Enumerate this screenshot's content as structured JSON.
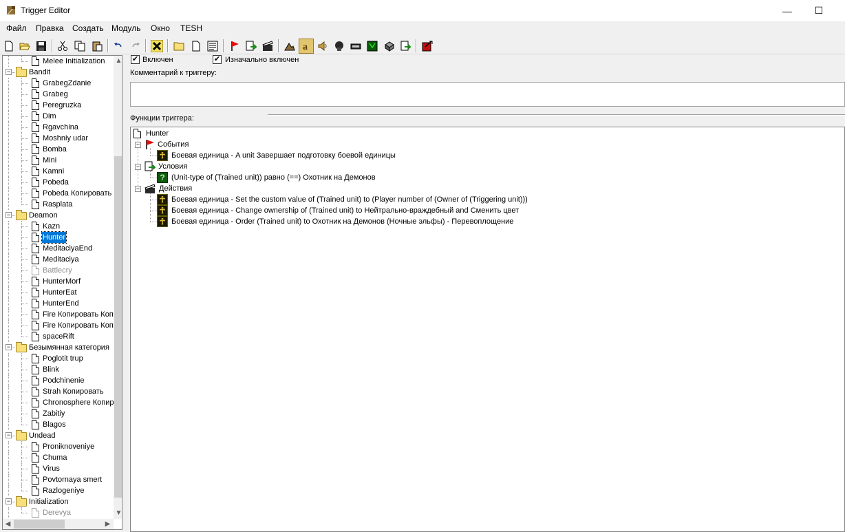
{
  "window": {
    "title": "Trigger Editor",
    "minimize": "—",
    "maximize": "☐"
  },
  "menu": [
    "Файл",
    "Правка",
    "Создать",
    "Модуль",
    "Окно",
    "TESH"
  ],
  "tree": {
    "rows": [
      {
        "label": "Melee Initialization",
        "type": "trigger",
        "level": 2
      },
      {
        "label": "Bandit",
        "type": "folder",
        "level": 1
      },
      {
        "label": "GrabegZdanie",
        "type": "trigger",
        "level": 2
      },
      {
        "label": "Grabeg",
        "type": "trigger",
        "level": 2
      },
      {
        "label": "Peregruzka",
        "type": "trigger",
        "level": 2
      },
      {
        "label": "Dim",
        "type": "trigger",
        "level": 2
      },
      {
        "label": "Rgavchina",
        "type": "trigger",
        "level": 2
      },
      {
        "label": "Moshniy udar",
        "type": "trigger",
        "level": 2
      },
      {
        "label": "Bomba",
        "type": "trigger",
        "level": 2
      },
      {
        "label": "Mini",
        "type": "trigger",
        "level": 2
      },
      {
        "label": "Kamni",
        "type": "trigger",
        "level": 2
      },
      {
        "label": "Pobeda",
        "type": "trigger",
        "level": 2
      },
      {
        "label": "Pobeda Копировать",
        "type": "trigger",
        "level": 2
      },
      {
        "label": "Rasplata",
        "type": "trigger",
        "level": 2
      },
      {
        "label": "Deamon",
        "type": "folder",
        "level": 1
      },
      {
        "label": "Kazn",
        "type": "trigger",
        "level": 2
      },
      {
        "label": "Hunter",
        "type": "trigger",
        "level": 2,
        "selected": true
      },
      {
        "label": "MeditaciyaEnd",
        "type": "trigger",
        "level": 2
      },
      {
        "label": "Meditaciya",
        "type": "trigger",
        "level": 2
      },
      {
        "label": "Battlecry",
        "type": "trigger",
        "level": 2,
        "disabled": true
      },
      {
        "label": "HunterMorf",
        "type": "trigger",
        "level": 2
      },
      {
        "label": "HunterEat",
        "type": "trigger",
        "level": 2
      },
      {
        "label": "HunterEnd",
        "type": "trigger",
        "level": 2
      },
      {
        "label": "Fire Копировать Коп",
        "type": "trigger",
        "level": 2
      },
      {
        "label": "Fire Копировать Коп",
        "type": "trigger",
        "level": 2
      },
      {
        "label": "spaceRift",
        "type": "trigger",
        "level": 2
      },
      {
        "label": "Безымянная категория",
        "type": "folder",
        "level": 1
      },
      {
        "label": "Poglotit trup",
        "type": "trigger",
        "level": 2
      },
      {
        "label": "Blink",
        "type": "trigger",
        "level": 2
      },
      {
        "label": "Podchinenie",
        "type": "trigger",
        "level": 2
      },
      {
        "label": "Strah Копировать",
        "type": "trigger",
        "level": 2
      },
      {
        "label": "Chronosphere Копир",
        "type": "trigger",
        "level": 2
      },
      {
        "label": "Zabitiy",
        "type": "trigger",
        "level": 2
      },
      {
        "label": "Blagos",
        "type": "trigger",
        "level": 2
      },
      {
        "label": "Undead",
        "type": "folder",
        "level": 1
      },
      {
        "label": "Proniknoveniye",
        "type": "trigger",
        "level": 2
      },
      {
        "label": "Chuma",
        "type": "trigger",
        "level": 2
      },
      {
        "label": "Virus",
        "type": "trigger",
        "level": 2
      },
      {
        "label": "Povtornaya smert",
        "type": "trigger",
        "level": 2
      },
      {
        "label": "Razlogeniye",
        "type": "trigger",
        "level": 2
      },
      {
        "label": "Initialization",
        "type": "folder",
        "level": 1
      },
      {
        "label": "Derevya",
        "type": "trigger",
        "level": 2,
        "disabled": true
      }
    ]
  },
  "trigger": {
    "enabled_label": "Включен",
    "initially_on_label": "Изначально включен",
    "comment_label": "Комментарий к триггеру:",
    "functions_label": "Функции триггера:",
    "name": "Hunter",
    "events_label": "События",
    "event_1": "Боевая единица - A unit Завершает подготовку боевой единицы",
    "conditions_label": "Условия",
    "condition_1": "(Unit-type of (Trained unit)) равно (==) Охотник на Демонов",
    "actions_label": "Действия",
    "action_1": "Боевая единица - Set the custom value of (Trained unit) to (Player number of (Owner of (Triggering unit)))",
    "action_2": "Боевая единица - Change ownership of (Trained unit) to Нейтрально-враждебный and Сменить цвет",
    "action_3": "Боевая единица - Order (Trained unit) to Охотник на Демонов (Ночные эльфы) - Перевоплощение"
  },
  "toolbar_icons": [
    "new-icon",
    "open-icon",
    "save-icon",
    "cut-icon",
    "copy-icon",
    "paste-icon",
    "undo-icon",
    "redo-icon",
    "delete-icon",
    "new-category-icon",
    "new-trigger-icon",
    "new-comment-icon",
    "new-event-icon",
    "new-condition-icon",
    "new-action-icon",
    "terrain-editor-icon",
    "trigger-editor-icon",
    "sound-editor-icon",
    "object-editor-icon",
    "campaign-editor-icon",
    "ai-editor-icon",
    "object-manager-icon",
    "import-manager-icon",
    "test-map-icon"
  ]
}
